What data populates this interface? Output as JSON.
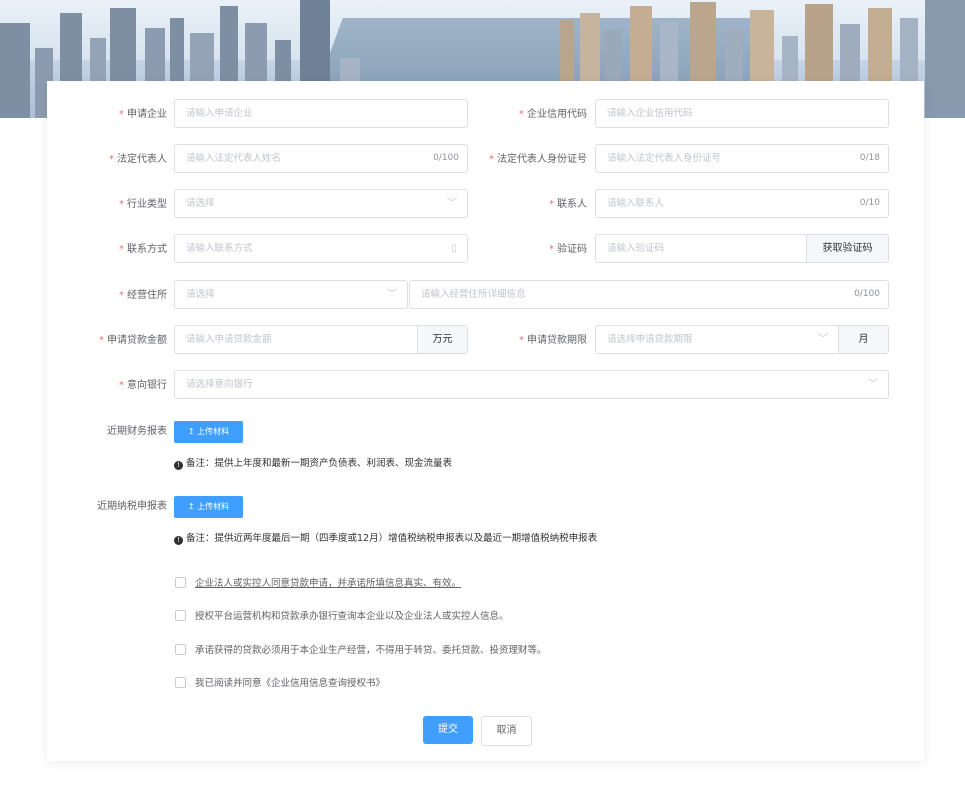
{
  "form": {
    "rows": [
      {
        "left": {
          "label": "申请企业",
          "required": true,
          "placeholder": "请输入申请企业"
        },
        "right": {
          "label": "企业信用代码",
          "required": true,
          "placeholder": "请输入企业信用代码"
        }
      },
      {
        "left": {
          "label": "法定代表人",
          "required": true,
          "placeholder": "请输入法定代表人姓名",
          "counter": "0/100"
        },
        "right": {
          "label": "法定代表人身份证号",
          "required": true,
          "placeholder": "请输入法定代表人身份证号",
          "counter": "0/18"
        }
      },
      {
        "left": {
          "label": "行业类型",
          "required": true,
          "placeholder": "请选择"
        },
        "right": {
          "label": "联系人",
          "required": true,
          "placeholder": "请输入联系人",
          "counter": "0/10"
        }
      },
      {
        "left": {
          "label": "联系方式",
          "required": true,
          "placeholder": "请输入联系方式"
        },
        "right": {
          "label": "验证码",
          "required": true,
          "placeholder": "请输入验证码",
          "button": "获取验证码"
        }
      }
    ],
    "address": {
      "label": "经营住所",
      "required": true,
      "select_placeholder": "请选择",
      "detail_placeholder": "请输入经营住所详细信息",
      "counter": "0/100"
    },
    "amount": {
      "label": "申请贷款金额",
      "required": true,
      "placeholder": "请输入申请贷款金额",
      "unit": "万元"
    },
    "term": {
      "label": "申请贷款期限",
      "required": true,
      "placeholder": "请选择申请贷款期限",
      "unit": "月"
    },
    "bank": {
      "label": "意向银行",
      "required": true,
      "placeholder": "请选择意向银行"
    },
    "financial": {
      "label": "近期财务报表",
      "upload": "上传材料",
      "note": "备注：提供上年度和最新一期资产负债表、利润表、现金流量表"
    },
    "tax": {
      "label": "近期纳税申报表",
      "upload": "上传材料",
      "note": "备注：提供近两年度最后一期（四季度或12月）增值税纳税申报表以及最近一期增值税纳税申报表"
    },
    "agreements": [
      "企业法人或实控人同意贷款申请，并承诺所填信息真实、有效。",
      "授权平台运营机构和贷款承办银行查询本企业以及企业法人或实控人信息。",
      "承诺获得的贷款必须用于本企业生产经营，不得用于转贷、委托贷款、投资理财等。",
      "我已阅读并同意《企业信用信息查询授权书》"
    ],
    "submit": "提交",
    "cancel": "取消",
    "required_mark": "*",
    "upload_icon": "↥",
    "note_icon": "!"
  },
  "colors": {
    "primary": "#409eff",
    "required": "#f56c6c",
    "border": "#dcdfe6"
  }
}
